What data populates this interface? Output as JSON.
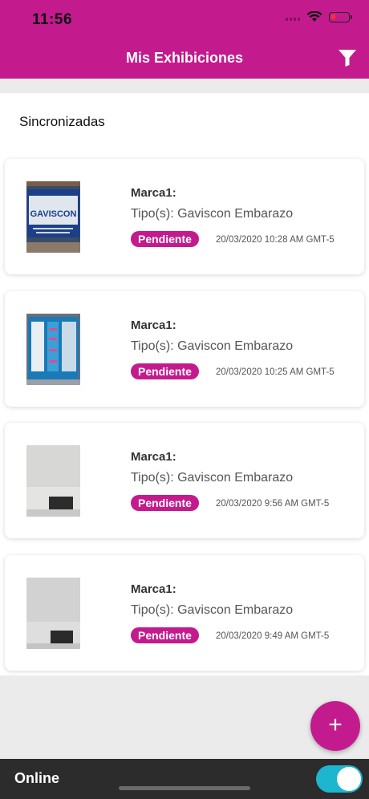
{
  "status_bar": {
    "time": "11:56"
  },
  "header": {
    "title": "Mis Exhibiciones",
    "filter_icon": "filter-icon"
  },
  "section": {
    "title": "Sincronizadas"
  },
  "items": [
    {
      "brand": "Marca1:",
      "tipo": "Tipo(s): Gaviscon Embarazo",
      "status": "Pendiente",
      "date": "20/03/2020 10:28 AM GMT-5",
      "thumb_text": "GAVISCON"
    },
    {
      "brand": "Marca1:",
      "tipo": "Tipo(s): Gaviscon Embarazo",
      "status": "Pendiente",
      "date": "20/03/2020 10:25 AM GMT-5"
    },
    {
      "brand": "Marca1:",
      "tipo": "Tipo(s): Gaviscon Embarazo",
      "status": "Pendiente",
      "date": "20/03/2020 9:56 AM GMT-5"
    },
    {
      "brand": "Marca1:",
      "tipo": "Tipo(s): Gaviscon Embarazo",
      "status": "Pendiente",
      "date": "20/03/2020 9:49 AM GMT-5"
    }
  ],
  "fab": {
    "label": "+"
  },
  "footer": {
    "online_label": "Online",
    "online_enabled": true
  },
  "colors": {
    "brand": "#c31b8e",
    "toggle": "#1eb5cf"
  }
}
